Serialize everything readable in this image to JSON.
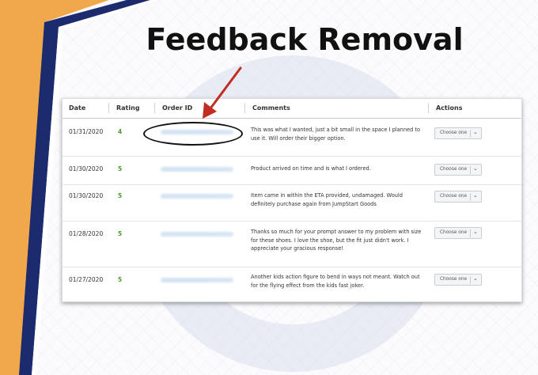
{
  "slide": {
    "title": "Feedback Removal",
    "colors": {
      "accent_orange": "#f0a84a",
      "accent_navy": "#1c2a6e",
      "arrow": "#c22d22",
      "rating_green": "#4a9a2a"
    }
  },
  "table": {
    "headers": [
      "Date",
      "Rating",
      "Order ID",
      "Comments",
      "Actions"
    ],
    "rows": [
      {
        "date": "01/31/2020",
        "rating": "4",
        "comment": "This was what I wanted, just a bit small in the space I planned to use it. Will order their bigger option.",
        "action": "Choose one"
      },
      {
        "date": "01/30/2020",
        "rating": "5",
        "comment": "Product arrived on time and is what I ordered.",
        "action": "Choose one"
      },
      {
        "date": "01/30/2020",
        "rating": "5",
        "comment": "Item came in within the ETA provided, undamaged. Would definitely purchase again from JumpStart Goods",
        "action": "Choose one"
      },
      {
        "date": "01/28/2020",
        "rating": "5",
        "comment": "Thanks so much for your prompt answer to my problem with size for these shoes. I love the shoe, but the fit just didn't work. I appreciate your gracious response!",
        "action": "Choose one"
      },
      {
        "date": "01/27/2020",
        "rating": "5",
        "comment": "Another kids action figure to bend in ways not meant. Watch out for the flying effect from the kids fast joker.",
        "action": "Choose one"
      }
    ]
  },
  "icons": {
    "dropdown": "chevron-down-icon",
    "annotation": "red-arrow-icon"
  }
}
